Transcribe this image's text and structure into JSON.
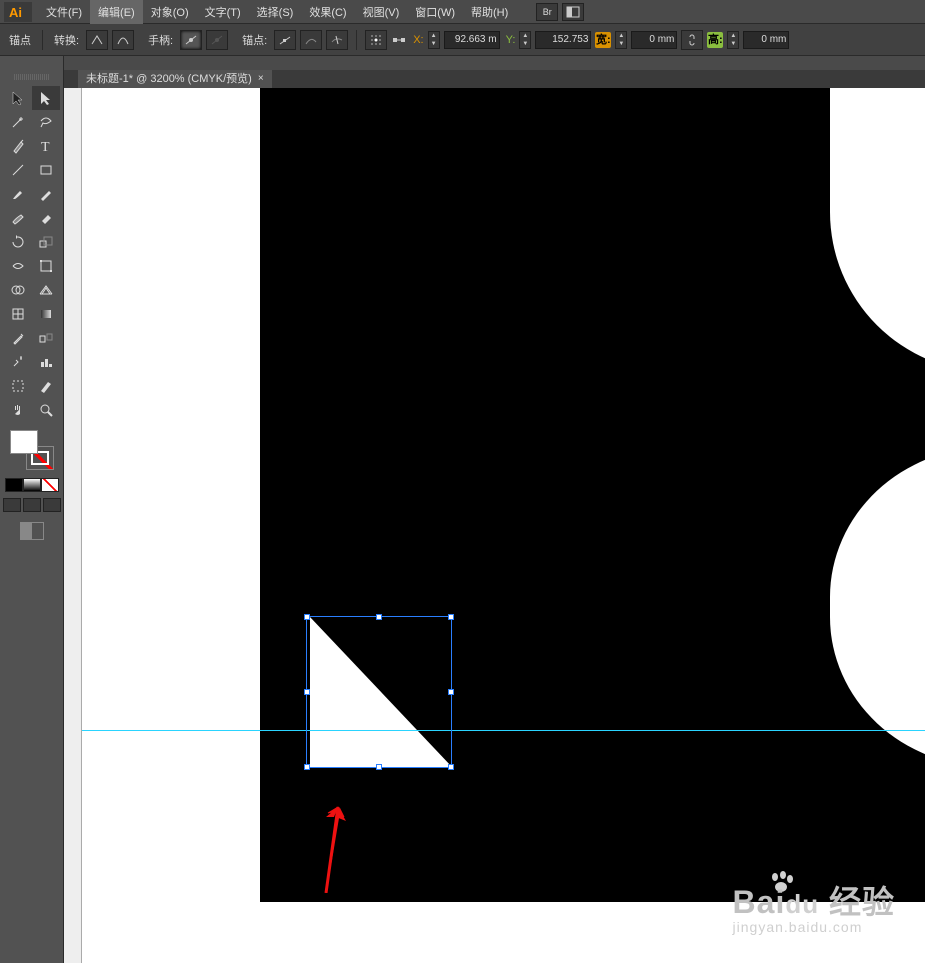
{
  "menu": {
    "file": "文件(F)",
    "edit": "编辑(E)",
    "object": "对象(O)",
    "type": "文字(T)",
    "select": "选择(S)",
    "effect": "效果(C)",
    "view": "视图(V)",
    "window": "窗口(W)",
    "help": "帮助(H)",
    "br_label": "Br"
  },
  "control": {
    "anchor_label": "锚点",
    "convert_label": "转换:",
    "handles_label": "手柄:",
    "anchors_label": "锚点:",
    "x_label": "X:",
    "y_label": "Y:",
    "x_value": "92.663 m",
    "y_value": "152.753",
    "w_label": "宽:",
    "h_label": "高:",
    "w_value": "0 mm",
    "h_value": "0 mm"
  },
  "tab": {
    "title": "未标题-1* @ 3200% (CMYK/预览)",
    "close": "×"
  },
  "watermark": {
    "brand": "Bai",
    "du": "du",
    "jingyan_cn": "经验",
    "url": "jingyan.baidu.com"
  }
}
